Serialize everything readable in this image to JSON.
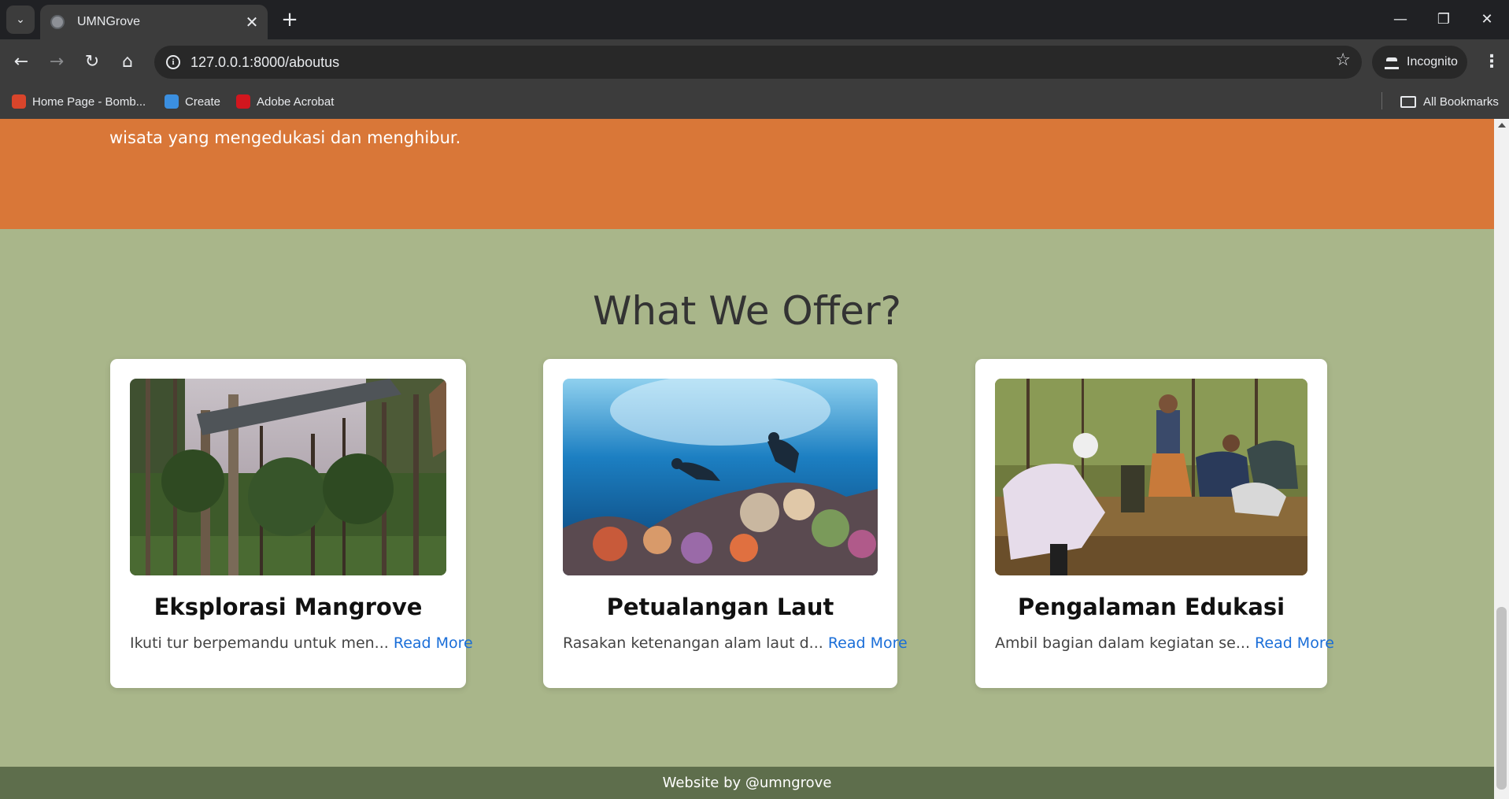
{
  "browser": {
    "tab_title": "UMNGrove",
    "url": "127.0.0.1:8000/aboutus",
    "incognito_label": "Incognito",
    "bookmarks": [
      {
        "label": "Home Page - Bomb...",
        "icon": "bombastic-favicon",
        "color": "#d9452b"
      },
      {
        "label": "Create",
        "icon": "create-favicon",
        "color": "#3b8fe0"
      },
      {
        "label": "Adobe Acrobat",
        "icon": "acrobat-favicon",
        "color": "#d2161e"
      }
    ],
    "all_bookmarks_label": "All Bookmarks"
  },
  "hero": {
    "text": "wisata yang mengedukasi dan menghibur.",
    "bg_color": "#d97738"
  },
  "offer": {
    "title": "What We Offer?",
    "cards": [
      {
        "title": "Eksplorasi Mangrove",
        "desc": "Ikuti tur berpemandu untuk men...",
        "link": "Read More",
        "image": "mangrove-forest-signboard-photo"
      },
      {
        "title": "Petualangan Laut",
        "desc": "Rasakan ketenangan alam laut d...",
        "link": "Read More",
        "image": "underwater-divers-coral-reef-photo"
      },
      {
        "title": "Pengalaman Edukasi",
        "desc": "Ambil bagian dalam kegiatan se...",
        "link": "Read More",
        "image": "people-planting-mangroves-photo"
      }
    ]
  },
  "footer": {
    "text": "Website by @umngrove"
  },
  "colors": {
    "section_bg": "#a9b68a",
    "footer_bg": "#5e6e4c",
    "link": "#1a6ed8"
  }
}
